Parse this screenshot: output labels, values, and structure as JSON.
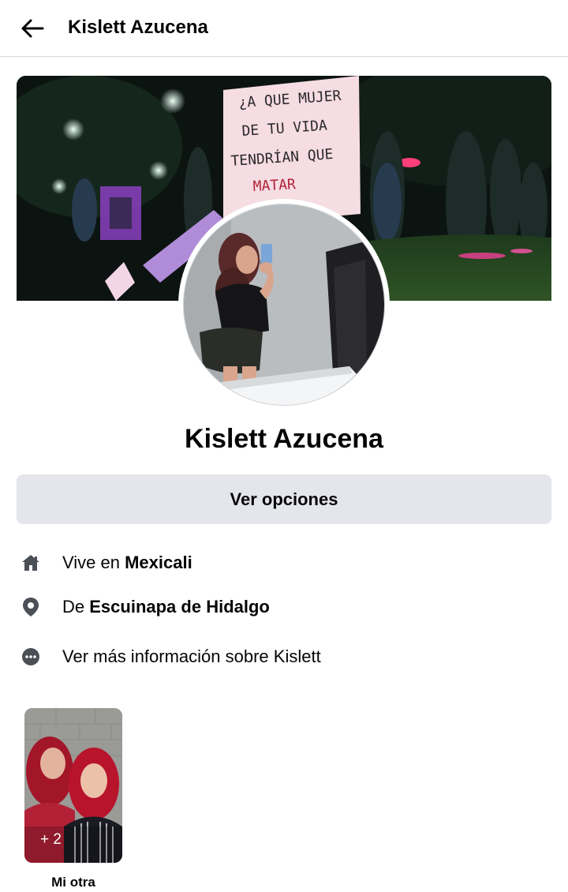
{
  "header": {
    "title": "Kislett Azucena",
    "back_icon": "arrow-left-icon"
  },
  "cover": {
    "sign_lines": [
      "¿A QUE MUJER",
      "DE TU VIDA",
      "TENDRÍAN QUE",
      "MATAR"
    ]
  },
  "profile": {
    "name": "Kislett Azucena"
  },
  "actions": {
    "options_label": "Ver opciones"
  },
  "info": {
    "lives_prefix": "Vive en ",
    "lives_value": "Mexicali",
    "from_prefix": "De ",
    "from_value": "Escuinapa de Hidalgo",
    "more_label": "Ver más información sobre Kislett"
  },
  "albums": [
    {
      "count": "+ 2",
      "label": "Mi otra"
    }
  ],
  "colors": {
    "text": "#050505",
    "button_bg": "#e4e6eb",
    "divider": "#d5d7da",
    "icon": "#4b4f56"
  }
}
